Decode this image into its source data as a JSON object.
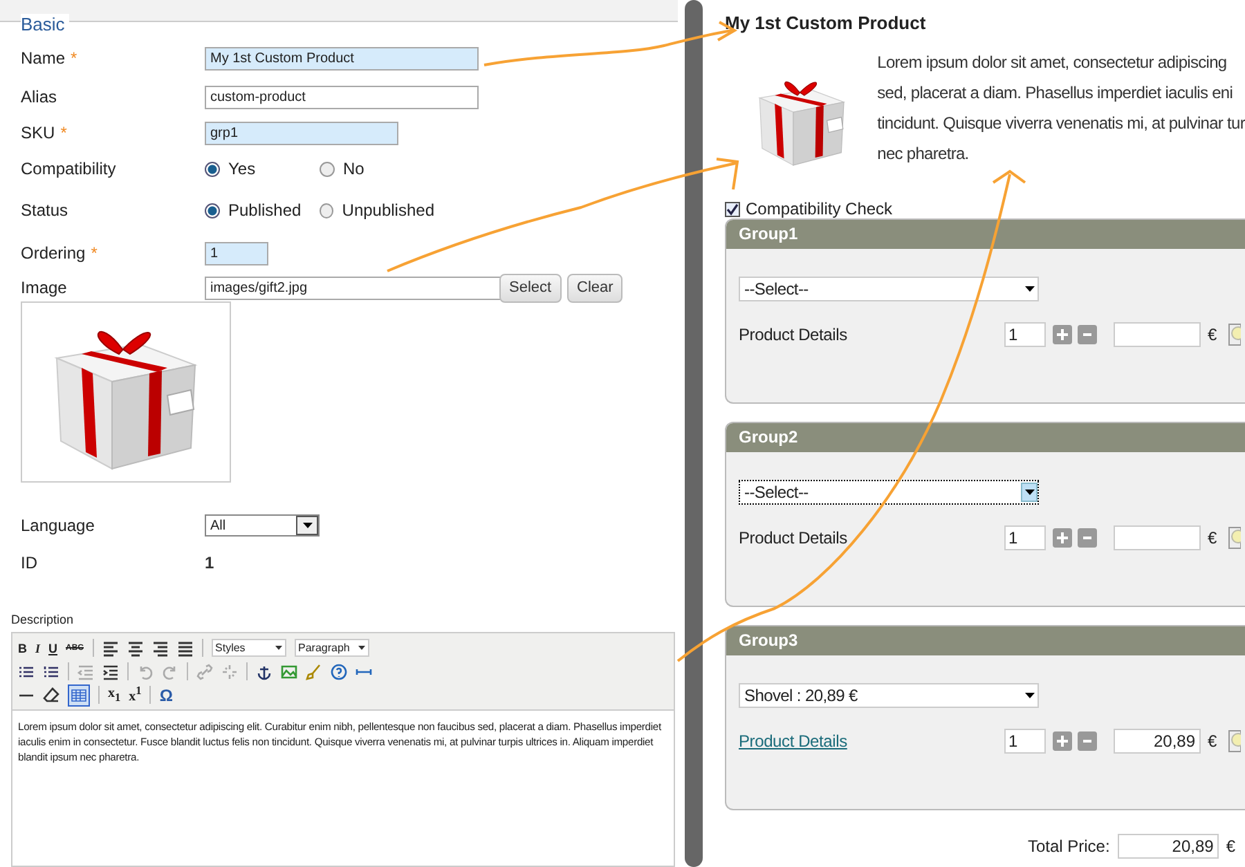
{
  "form": {
    "legend": "Basic",
    "required_mark": "*",
    "fields": [
      {
        "kind": "text",
        "label": "Name",
        "required": true,
        "value": "My 1st Custom Product"
      },
      {
        "kind": "text",
        "label": "Alias",
        "required": false,
        "value": "custom-product"
      },
      {
        "kind": "text",
        "label": "SKU",
        "required": true,
        "value": "grp1"
      },
      {
        "kind": "radio",
        "label": "Compatibility",
        "options": [
          {
            "label": "Yes",
            "selected": true
          },
          {
            "label": "No",
            "selected": false
          }
        ]
      },
      {
        "kind": "radio",
        "label": "Status",
        "options": [
          {
            "label": "Published",
            "selected": true
          },
          {
            "label": "Unpublished",
            "selected": false
          }
        ]
      },
      {
        "kind": "text",
        "label": "Ordering",
        "required": true,
        "value": "1"
      },
      {
        "kind": "file",
        "label": "Image",
        "value": "images/gift2.jpg",
        "buttons": [
          "Select",
          "Clear"
        ]
      },
      {
        "kind": "preview"
      },
      {
        "kind": "select",
        "label": "Language",
        "value": "All"
      },
      {
        "kind": "static",
        "label": "ID",
        "value": "1"
      }
    ]
  },
  "description": {
    "label": "Description",
    "format_buttons": [
      "B",
      "I",
      "U",
      "ABC"
    ],
    "styles": "Styles",
    "paragraph": "Paragraph",
    "script_buttons": [
      "x$_{1}$",
      "x$^{1}$"
    ],
    "special_char": "Ω",
    "text": "Lorem ipsum dolor sit amet, consectetur adipiscing elit. Curabitur enim nibh, pellentesque non faucibus sed, placerat a diam. Phasellus imperdiet iaculis enim in consectetur. Fusce blandit luctus felis non tincidunt. Quisque viverra venenatis mi, at pulvinar turpis ultrices in. Aliquam imperdiet blandit ipsum nec pharetra."
  },
  "preview": {
    "title": "My 1st Custom Product",
    "text_lines": [
      "Lorem ipsum dolor sit amet, consectetur adipiscing",
      "sed, placerat a diam. Phasellus imperdiet iaculis eni",
      "tincidunt. Quisque viverra venenatis mi, at pulvinar tur",
      "nec pharetra."
    ],
    "compatibility_check": {
      "label": "Compatibility Check",
      "checked": true
    },
    "groups": [
      {
        "title": "Group1",
        "select": "--Select--",
        "focused": false,
        "details": "Product Details",
        "details_link": false,
        "quantity": "1",
        "currency": "€"
      },
      {
        "title": "Group2",
        "select": "--Select--",
        "focused": true,
        "details": "Product Details",
        "details_link": false,
        "quantity": "1",
        "currency": "€"
      },
      {
        "title": "Group3",
        "select": "Shovel : 20,89 €",
        "focused": false,
        "details": "Product Details",
        "details_link": true,
        "quantity": "1",
        "price": "20,89",
        "currency": "€"
      }
    ],
    "total": {
      "label": "Total Price:",
      "value": "20,89",
      "currency": "€"
    }
  }
}
